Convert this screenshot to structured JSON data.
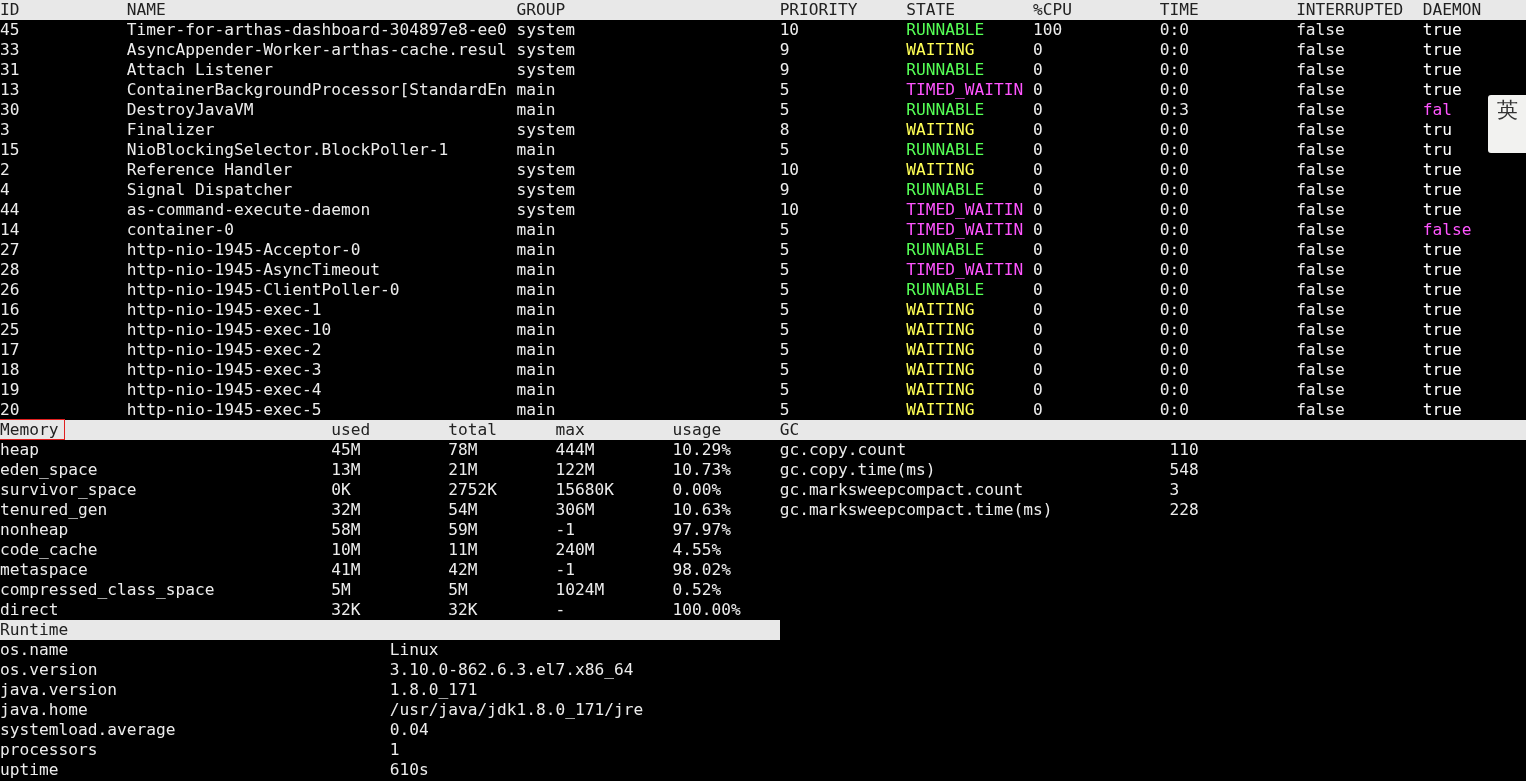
{
  "threads": {
    "columns": [
      "ID",
      "NAME",
      "GROUP",
      "PRIORITY",
      "STATE",
      "%CPU",
      "TIME",
      "INTERRUPTED",
      "DAEMON"
    ],
    "rows": [
      {
        "id": "45",
        "name": "Timer-for-arthas-dashboard-304897e8-ee0",
        "group": "system",
        "priority": "10",
        "state": {
          "text": "RUNNABLE",
          "color": "#55ff55"
        },
        "cpu": "100",
        "time": "0:0",
        "interrupted": "false",
        "daemon": {
          "text": "true",
          "color": "#ffffff"
        }
      },
      {
        "id": "33",
        "name": "AsyncAppender-Worker-arthas-cache.resul",
        "group": "system",
        "priority": "9",
        "state": {
          "text": "WAITING",
          "color": "#ffff55"
        },
        "cpu": "0",
        "time": "0:0",
        "interrupted": "false",
        "daemon": {
          "text": "true",
          "color": "#ffffff"
        }
      },
      {
        "id": "31",
        "name": "Attach Listener",
        "group": "system",
        "priority": "9",
        "state": {
          "text": "RUNNABLE",
          "color": "#55ff55"
        },
        "cpu": "0",
        "time": "0:0",
        "interrupted": "false",
        "daemon": {
          "text": "true",
          "color": "#ffffff"
        }
      },
      {
        "id": "13",
        "name": "ContainerBackgroundProcessor[StandardEn",
        "group": "main",
        "priority": "5",
        "state": {
          "text": "TIMED_WAITIN",
          "color": "#ff55ff"
        },
        "cpu": "0",
        "time": "0:0",
        "interrupted": "false",
        "daemon": {
          "text": "true",
          "color": "#ffffff"
        }
      },
      {
        "id": "30",
        "name": "DestroyJavaVM",
        "group": "main",
        "priority": "5",
        "state": {
          "text": "RUNNABLE",
          "color": "#55ff55"
        },
        "cpu": "0",
        "time": "0:3",
        "interrupted": "false",
        "daemon": {
          "text": "fal",
          "color": "#ff55ff"
        }
      },
      {
        "id": "3",
        "name": "Finalizer",
        "group": "system",
        "priority": "8",
        "state": {
          "text": "WAITING",
          "color": "#ffff55"
        },
        "cpu": "0",
        "time": "0:0",
        "interrupted": "false",
        "daemon": {
          "text": "tru",
          "color": "#ffffff"
        }
      },
      {
        "id": "15",
        "name": "NioBlockingSelector.BlockPoller-1",
        "group": "main",
        "priority": "5",
        "state": {
          "text": "RUNNABLE",
          "color": "#55ff55"
        },
        "cpu": "0",
        "time": "0:0",
        "interrupted": "false",
        "daemon": {
          "text": "tru",
          "color": "#ffffff"
        }
      },
      {
        "id": "2",
        "name": "Reference Handler",
        "group": "system",
        "priority": "10",
        "state": {
          "text": "WAITING",
          "color": "#ffff55"
        },
        "cpu": "0",
        "time": "0:0",
        "interrupted": "false",
        "daemon": {
          "text": "true",
          "color": "#ffffff"
        }
      },
      {
        "id": "4",
        "name": "Signal Dispatcher",
        "group": "system",
        "priority": "9",
        "state": {
          "text": "RUNNABLE",
          "color": "#55ff55"
        },
        "cpu": "0",
        "time": "0:0",
        "interrupted": "false",
        "daemon": {
          "text": "true",
          "color": "#ffffff"
        }
      },
      {
        "id": "44",
        "name": "as-command-execute-daemon",
        "group": "system",
        "priority": "10",
        "state": {
          "text": "TIMED_WAITIN",
          "color": "#ff55ff"
        },
        "cpu": "0",
        "time": "0:0",
        "interrupted": "false",
        "daemon": {
          "text": "true",
          "color": "#ffffff"
        }
      },
      {
        "id": "14",
        "name": "container-0",
        "group": "main",
        "priority": "5",
        "state": {
          "text": "TIMED_WAITIN",
          "color": "#ff55ff"
        },
        "cpu": "0",
        "time": "0:0",
        "interrupted": "false",
        "daemon": {
          "text": "false",
          "color": "#ff55ff"
        }
      },
      {
        "id": "27",
        "name": "http-nio-1945-Acceptor-0",
        "group": "main",
        "priority": "5",
        "state": {
          "text": "RUNNABLE",
          "color": "#55ff55"
        },
        "cpu": "0",
        "time": "0:0",
        "interrupted": "false",
        "daemon": {
          "text": "true",
          "color": "#ffffff"
        }
      },
      {
        "id": "28",
        "name": "http-nio-1945-AsyncTimeout",
        "group": "main",
        "priority": "5",
        "state": {
          "text": "TIMED_WAITIN",
          "color": "#ff55ff"
        },
        "cpu": "0",
        "time": "0:0",
        "interrupted": "false",
        "daemon": {
          "text": "true",
          "color": "#ffffff"
        }
      },
      {
        "id": "26",
        "name": "http-nio-1945-ClientPoller-0",
        "group": "main",
        "priority": "5",
        "state": {
          "text": "RUNNABLE",
          "color": "#55ff55"
        },
        "cpu": "0",
        "time": "0:0",
        "interrupted": "false",
        "daemon": {
          "text": "true",
          "color": "#ffffff"
        }
      },
      {
        "id": "16",
        "name": "http-nio-1945-exec-1",
        "group": "main",
        "priority": "5",
        "state": {
          "text": "WAITING",
          "color": "#ffff55"
        },
        "cpu": "0",
        "time": "0:0",
        "interrupted": "false",
        "daemon": {
          "text": "true",
          "color": "#ffffff"
        }
      },
      {
        "id": "25",
        "name": "http-nio-1945-exec-10",
        "group": "main",
        "priority": "5",
        "state": {
          "text": "WAITING",
          "color": "#ffff55"
        },
        "cpu": "0",
        "time": "0:0",
        "interrupted": "false",
        "daemon": {
          "text": "true",
          "color": "#ffffff"
        }
      },
      {
        "id": "17",
        "name": "http-nio-1945-exec-2",
        "group": "main",
        "priority": "5",
        "state": {
          "text": "WAITING",
          "color": "#ffff55"
        },
        "cpu": "0",
        "time": "0:0",
        "interrupted": "false",
        "daemon": {
          "text": "true",
          "color": "#ffffff"
        }
      },
      {
        "id": "18",
        "name": "http-nio-1945-exec-3",
        "group": "main",
        "priority": "5",
        "state": {
          "text": "WAITING",
          "color": "#ffff55"
        },
        "cpu": "0",
        "time": "0:0",
        "interrupted": "false",
        "daemon": {
          "text": "true",
          "color": "#ffffff"
        }
      },
      {
        "id": "19",
        "name": "http-nio-1945-exec-4",
        "group": "main",
        "priority": "5",
        "state": {
          "text": "WAITING",
          "color": "#ffff55"
        },
        "cpu": "0",
        "time": "0:0",
        "interrupted": "false",
        "daemon": {
          "text": "true",
          "color": "#ffffff"
        }
      },
      {
        "id": "20",
        "name": "http-nio-1945-exec-5",
        "group": "main",
        "priority": "5",
        "state": {
          "text": "WAITING",
          "color": "#ffff55"
        },
        "cpu": "0",
        "time": "0:0",
        "interrupted": "false",
        "daemon": {
          "text": "true",
          "color": "#ffffff"
        }
      }
    ]
  },
  "memory": {
    "first_column_highlighted": true,
    "columns": [
      "Memory",
      "used",
      "total",
      "max",
      "usage"
    ],
    "rows": [
      [
        "heap",
        "45M",
        "78M",
        "444M",
        "10.29%"
      ],
      [
        "eden_space",
        "13M",
        "21M",
        "122M",
        "10.73%"
      ],
      [
        "survivor_space",
        "0K",
        "2752K",
        "15680K",
        "0.00%"
      ],
      [
        "tenured_gen",
        "32M",
        "54M",
        "306M",
        "10.63%"
      ],
      [
        "nonheap",
        "58M",
        "59M",
        "-1",
        "97.97%"
      ],
      [
        "code_cache",
        "10M",
        "11M",
        "240M",
        "4.55%"
      ],
      [
        "metaspace",
        "41M",
        "42M",
        "-1",
        "98.02%"
      ],
      [
        "compressed_class_space",
        "5M",
        "5M",
        "1024M",
        "0.52%"
      ],
      [
        "direct",
        "32K",
        "32K",
        "-",
        "100.00%"
      ]
    ]
  },
  "gc": {
    "title": "GC",
    "rows": [
      [
        "gc.copy.count",
        "110"
      ],
      [
        "gc.copy.time(ms)",
        "548"
      ],
      [
        "gc.marksweepcompact.count",
        "3"
      ],
      [
        "gc.marksweepcompact.time(ms)",
        "228"
      ]
    ]
  },
  "runtime": {
    "title": "Runtime",
    "rows": [
      [
        "os.name",
        "Linux"
      ],
      [
        "os.version",
        "3.10.0-862.6.3.el7.x86_64"
      ],
      [
        "java.version",
        "1.8.0_171"
      ],
      [
        "java.home",
        "/usr/java/jdk1.8.0_171/jre"
      ],
      [
        "systemload.average",
        "0.04"
      ],
      [
        "processors",
        "1"
      ],
      [
        "uptime",
        "610s"
      ]
    ]
  },
  "ime_indicator": {
    "label": "英"
  }
}
